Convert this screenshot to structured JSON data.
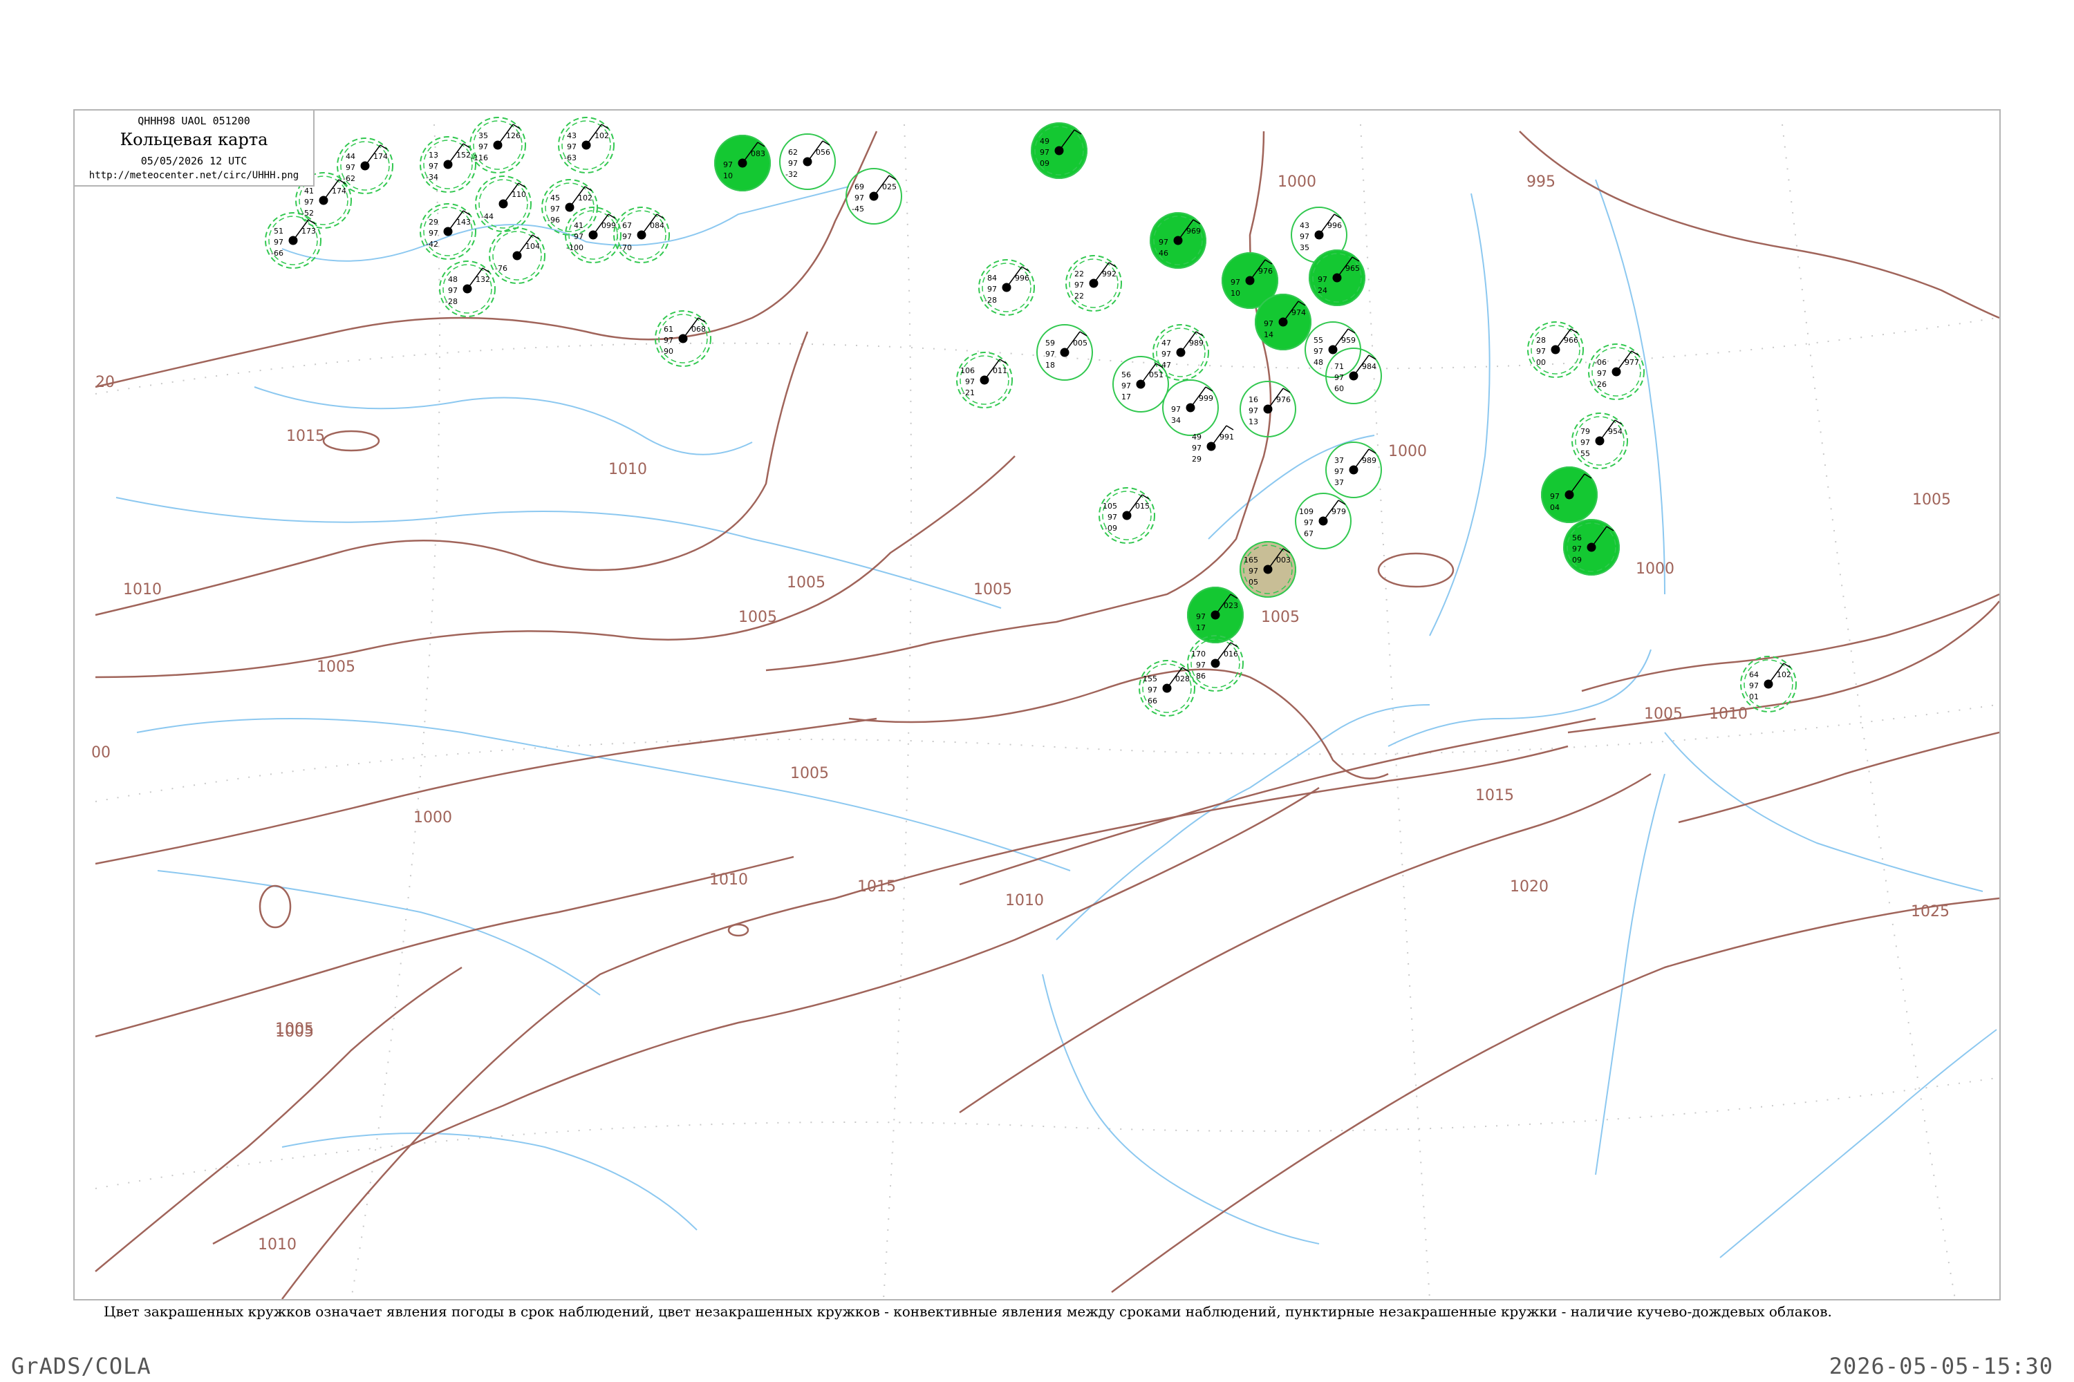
{
  "header": {
    "code": "QHHH98 UAOL 051200",
    "title": "Кольцевая карта",
    "datetime": "05/05/2026 12 UTC",
    "url": "http://meteocenter.net/circ/UHHH.png"
  },
  "caption": "Цвет закрашенных кружков означает явления погоды в срок наблюдений, цвет незакрашенных кружков - конвективные явления между сроками наблюдений, пунктирные незакрашенные кружки - наличие кучево-дождевых облаков.",
  "footer": {
    "left": "GrADS/COLA",
    "right": "2026-05-05-15:30"
  },
  "colors": {
    "isobar": "#a0645a",
    "coast": "#8cc8f0",
    "shower_fill": "#14c832",
    "haze_fill": "#c8be96",
    "ring": "#32c850",
    "grid": "#c8c8c8"
  },
  "isobar_labels": [
    "20",
    "1015",
    "1010",
    "1010",
    "1005",
    "1005",
    "1005",
    "1005",
    "1005",
    "1000",
    "00",
    "1005",
    "1010",
    "1015",
    "1010",
    "1005",
    "1010",
    "1000",
    "995",
    "1000",
    "1005",
    "1000",
    "1005",
    "1010",
    "1015",
    "1020",
    "1025",
    "1005"
  ],
  "stations": [
    {
      "id": "s1",
      "values": [
        "44",
        "97",
        "-62"
      ],
      "pressure": "174",
      "name": "",
      "ring": "dashed",
      "fill": "none"
    },
    {
      "id": "s2",
      "values": [
        "41",
        "97",
        "-52"
      ],
      "pressure": "174",
      "name": "",
      "ring": "dashed",
      "fill": "none"
    },
    {
      "id": "s3",
      "values": [
        "13",
        "97",
        "-34"
      ],
      "pressure": "152",
      "name": "",
      "ring": "dashed",
      "fill": "none"
    },
    {
      "id": "s4",
      "values": [
        "35",
        "97",
        "-116"
      ],
      "pressure": "126",
      "name": "",
      "ring": "dashed",
      "fill": "none"
    },
    {
      "id": "s5",
      "values": [
        "43",
        "97",
        "-63"
      ],
      "pressure": "102",
      "name": "",
      "ring": "dashed",
      "fill": "none"
    },
    {
      "id": "s6",
      "values": [
        "51",
        "97",
        "-66"
      ],
      "pressure": "173",
      "name": "",
      "ring": "dashed",
      "fill": "none"
    },
    {
      "id": "s7",
      "values": [
        "29",
        "97",
        "-42"
      ],
      "pressure": "143",
      "name": "",
      "ring": "dashed",
      "fill": "none"
    },
    {
      "id": "s8",
      "values": [
        "",
        "",
        "-44"
      ],
      "pressure": "110",
      "name": "",
      "ring": "dashed",
      "fill": "none"
    },
    {
      "id": "s9",
      "values": [
        "45",
        "97",
        "-96"
      ],
      "pressure": "102",
      "name": "",
      "ring": "dashed",
      "fill": "none"
    },
    {
      "id": "s10",
      "values": [
        "41",
        "97",
        "-100"
      ],
      "pressure": "099",
      "name": "",
      "ring": "dashed",
      "fill": "none"
    },
    {
      "id": "s11",
      "values": [
        "67",
        "97",
        "-70"
      ],
      "pressure": "084",
      "name": "",
      "ring": "dashed",
      "fill": "none"
    },
    {
      "id": "s12",
      "values": [
        "48",
        "97",
        "-28"
      ],
      "pressure": "132",
      "name": "",
      "ring": "dashed",
      "fill": "none"
    },
    {
      "id": "s13",
      "values": [
        "",
        "",
        "-76"
      ],
      "pressure": "104",
      "name": "",
      "ring": "dashed",
      "fill": "none"
    },
    {
      "id": "s14",
      "values": [
        "61",
        "97",
        "-90"
      ],
      "pressure": "068",
      "name": "",
      "ring": "dashed",
      "fill": "none"
    },
    {
      "id": "s15",
      "values": [
        "",
        "97",
        "10"
      ],
      "pressure": "083",
      "name": "",
      "ring": "solid",
      "fill": "shower"
    },
    {
      "id": "s16",
      "values": [
        "62",
        "97",
        "-32"
      ],
      "pressure": "056",
      "name": "",
      "ring": "solid",
      "fill": "none"
    },
    {
      "id": "s17",
      "values": [
        "69",
        "97",
        "-45"
      ],
      "pressure": "025",
      "name": "",
      "ring": "solid",
      "fill": "none"
    },
    {
      "id": "s18",
      "values": [
        "49",
        "97",
        "09"
      ],
      "pressure": "",
      "name": "",
      "ring": "dashed",
      "fill": "shower"
    },
    {
      "id": "s19",
      "values": [
        "",
        "97",
        "46"
      ],
      "pressure": "969",
      "name": "",
      "ring": "dashed",
      "fill": "shower"
    },
    {
      "id": "s20",
      "values": [
        "",
        "97",
        "10"
      ],
      "pressure": "976",
      "name": "",
      "ring": "solid",
      "fill": "shower"
    },
    {
      "id": "s21",
      "values": [
        "43",
        "97",
        "35"
      ],
      "pressure": "996",
      "name": "",
      "ring": "solid",
      "fill": "none"
    },
    {
      "id": "s22",
      "values": [
        "",
        "97",
        "24"
      ],
      "pressure": "965",
      "name": "",
      "ring": "dashed",
      "fill": "shower"
    },
    {
      "id": "s23",
      "values": [
        "",
        "97",
        "14"
      ],
      "pressure": "974",
      "name": "",
      "ring": "solid",
      "fill": "shower"
    },
    {
      "id": "s24",
      "values": [
        "84",
        "97",
        "-28"
      ],
      "pressure": "996",
      "name": "",
      "ring": "dashed",
      "fill": "none"
    },
    {
      "id": "s25",
      "values": [
        "22",
        "97",
        "22"
      ],
      "pressure": "992",
      "name": "",
      "ring": "dashed",
      "fill": "none"
    },
    {
      "id": "s26",
      "values": [
        "59",
        "97",
        "18"
      ],
      "pressure": "005",
      "name": "",
      "ring": "solid",
      "fill": "none"
    },
    {
      "id": "s27",
      "values": [
        "47",
        "97",
        "47"
      ],
      "pressure": "989",
      "name": "",
      "ring": "dashed",
      "fill": "none"
    },
    {
      "id": "s28",
      "values": [
        "55",
        "97",
        "48"
      ],
      "pressure": "959",
      "name": "",
      "ring": "solid",
      "fill": "none"
    },
    {
      "id": "s29",
      "values": [
        "71",
        "97",
        "60"
      ],
      "pressure": "984",
      "name": "",
      "ring": "solid",
      "fill": "none"
    },
    {
      "id": "s30",
      "values": [
        "106",
        "97",
        "-21"
      ],
      "pressure": "011",
      "name": "",
      "ring": "dashed",
      "fill": "none"
    },
    {
      "id": "s31",
      "values": [
        "56",
        "97",
        "17"
      ],
      "pressure": "051",
      "name": "",
      "ring": "solid",
      "fill": "none"
    },
    {
      "id": "s32",
      "values": [
        "",
        "97",
        "34"
      ],
      "pressure": "999",
      "name": "",
      "ring": "solid",
      "fill": "none"
    },
    {
      "id": "s33",
      "values": [
        "16",
        "97",
        "13"
      ],
      "pressure": "976",
      "name": "",
      "ring": "solid",
      "fill": "none"
    },
    {
      "id": "s34",
      "values": [
        "49",
        "97",
        "29"
      ],
      "pressure": "991",
      "name": "",
      "ring": "none",
      "fill": "none"
    },
    {
      "id": "s35",
      "values": [
        "37",
        "97",
        "37"
      ],
      "pressure": "989",
      "name": "",
      "ring": "solid",
      "fill": "none"
    },
    {
      "id": "s36",
      "values": [
        "109",
        "97",
        "67"
      ],
      "pressure": "979",
      "name": "",
      "ring": "solid",
      "fill": "none"
    },
    {
      "id": "s37",
      "values": [
        "28",
        "97",
        "00"
      ],
      "pressure": "966",
      "name": "",
      "ring": "dashed",
      "fill": "none"
    },
    {
      "id": "s38",
      "values": [
        "-06",
        "97",
        "-26"
      ],
      "pressure": "977",
      "name": "",
      "ring": "dashed",
      "fill": "none"
    },
    {
      "id": "s39",
      "values": [
        "79",
        "97",
        "55"
      ],
      "pressure": "954",
      "name": "",
      "ring": "dashed",
      "fill": "none"
    },
    {
      "id": "s40",
      "values": [
        "",
        "97",
        "04"
      ],
      "pressure": "",
      "name": "",
      "ring": "solid",
      "fill": "shower"
    },
    {
      "id": "s41",
      "values": [
        "56",
        "97",
        "09"
      ],
      "pressure": "",
      "name": "",
      "ring": "dashed",
      "fill": "shower"
    },
    {
      "id": "s42",
      "values": [
        "105",
        "97",
        "-09"
      ],
      "pressure": "015",
      "name": "",
      "ring": "dashed",
      "fill": "none"
    },
    {
      "id": "s43",
      "values": [
        "165",
        "97",
        "05"
      ],
      "pressure": "003",
      "name": "",
      "ring": "dashed",
      "fill": "haze"
    },
    {
      "id": "s44",
      "values": [
        "",
        "97",
        "17"
      ],
      "pressure": "023",
      "name": "",
      "ring": "solid",
      "fill": "shower"
    },
    {
      "id": "s45",
      "values": [
        "170",
        "97",
        "86"
      ],
      "pressure": "016",
      "name": "",
      "ring": "dashed",
      "fill": "none"
    },
    {
      "id": "s46",
      "values": [
        "155",
        "97",
        "66"
      ],
      "pressure": "028",
      "name": "",
      "ring": "dashed",
      "fill": "none"
    },
    {
      "id": "s47",
      "values": [
        "64",
        "97",
        "01"
      ],
      "pressure": "102",
      "name": "",
      "ring": "dashed",
      "fill": "none"
    }
  ]
}
